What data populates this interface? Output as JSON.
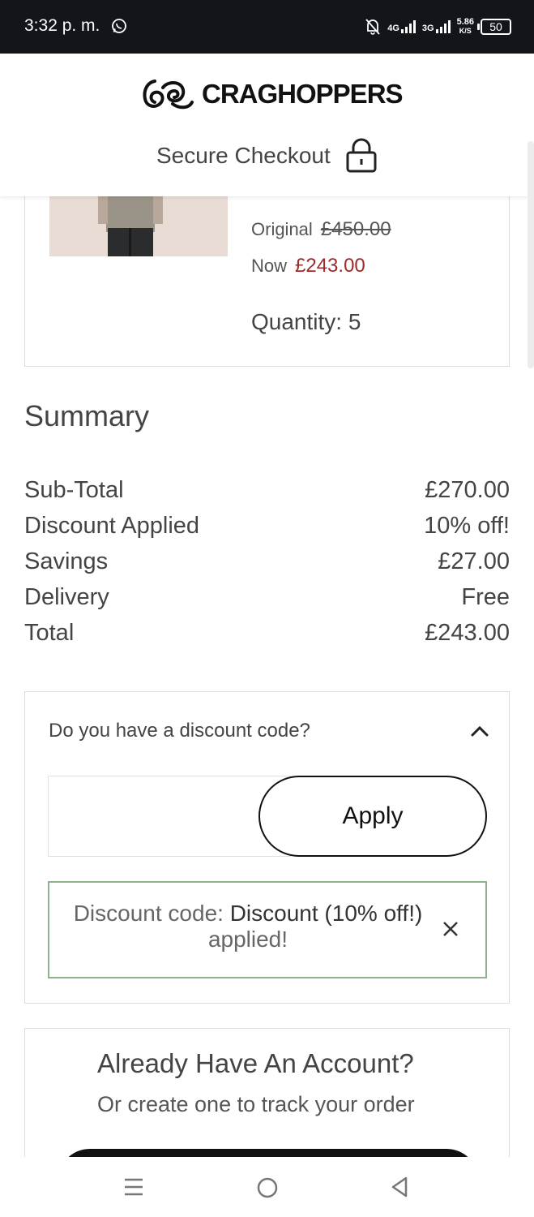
{
  "status_bar": {
    "time": "3:32 p. m.",
    "net1": "4G",
    "net2": "3G",
    "speed_top": "5.86",
    "speed_unit": "K/S",
    "battery": "50"
  },
  "header": {
    "brand": "CRAGHOPPERS",
    "secure_checkout": "Secure Checkout"
  },
  "product": {
    "original_label": "Original",
    "original_price": "£450.00",
    "now_label": "Now",
    "now_price": "£243.00",
    "quantity": "Quantity: 5"
  },
  "summary": {
    "title": "Summary",
    "rows": [
      {
        "label": "Sub-Total",
        "value": "£270.00"
      },
      {
        "label": "Discount Applied",
        "value": "10% off!"
      },
      {
        "label": "Savings",
        "value": "£27.00"
      },
      {
        "label": "Delivery",
        "value": "Free"
      },
      {
        "label": "Total",
        "value": "£243.00"
      }
    ]
  },
  "discount": {
    "question": "Do you have a discount code?",
    "input_value": "",
    "apply_label": "Apply",
    "applied_prefix": "Discount code: ",
    "applied_code": "Discount (10% off!)",
    "applied_suffix": " applied!"
  },
  "account": {
    "title": "Already Have An Account?",
    "subtitle": "Or create one to track your order"
  },
  "colors": {
    "price_red": "#9e2a2b",
    "applied_border": "#8fb38c",
    "status_bar_bg": "#12151a"
  }
}
